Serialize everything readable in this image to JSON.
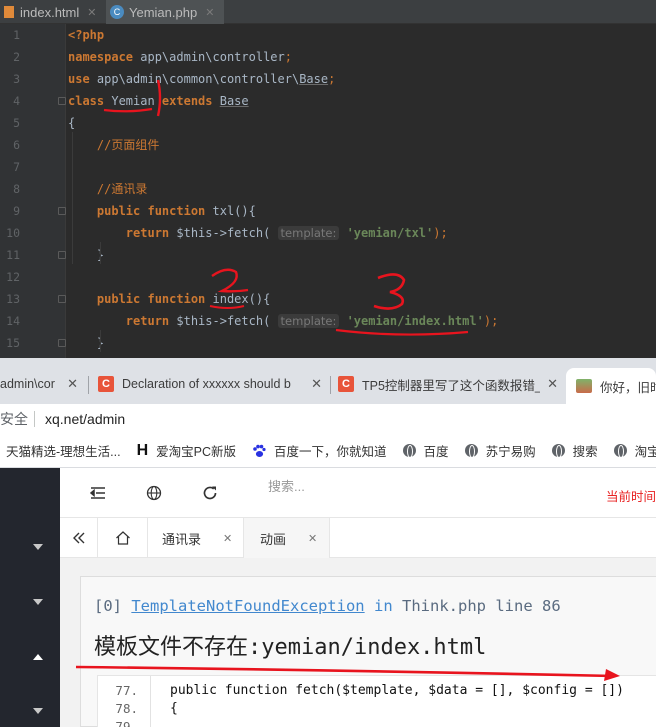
{
  "ide": {
    "tabs": [
      {
        "label": "index.html"
      },
      {
        "label": "Yemian.php"
      }
    ],
    "lines": [
      {
        "n": "1",
        "tokens": [
          {
            "t": "<?php",
            "c": "kw"
          }
        ]
      },
      {
        "n": "2",
        "tokens": [
          {
            "t": "namespace",
            "c": "kw"
          },
          {
            "t": " app\\admin\\controller",
            "c": "ns"
          },
          {
            "t": ";",
            "c": "cmt"
          }
        ]
      },
      {
        "n": "3",
        "tokens": [
          {
            "t": "use",
            "c": "kw"
          },
          {
            "t": " app\\admin\\common\\controller\\",
            "c": "ns"
          },
          {
            "t": "Base",
            "c": "cls"
          },
          {
            "t": ";",
            "c": "cmt"
          }
        ]
      },
      {
        "n": "4",
        "tokens": [
          {
            "t": "class",
            "c": "kw"
          },
          {
            "t": " Yemian ",
            "c": "ns"
          },
          {
            "t": "extends",
            "c": "kw"
          },
          {
            "t": " ",
            "c": "ns"
          },
          {
            "t": "Base",
            "c": "cls"
          }
        ]
      },
      {
        "n": "5",
        "tokens": [
          {
            "t": "{",
            "c": "ns"
          }
        ]
      },
      {
        "n": "6",
        "tokens": [
          {
            "t": "    //页面组件",
            "c": "cmt"
          }
        ]
      },
      {
        "n": "7",
        "tokens": []
      },
      {
        "n": "8",
        "tokens": [
          {
            "t": "    //通讯录",
            "c": "cmt"
          }
        ]
      },
      {
        "n": "9",
        "tokens": [
          {
            "t": "    public function",
            "c": "kw"
          },
          {
            "t": " txl(){",
            "c": "ns"
          }
        ]
      },
      {
        "n": "10",
        "tokens": [
          {
            "t": "        return",
            "c": "kw"
          },
          {
            "t": " $this->fetch( ",
            "c": "var"
          },
          {
            "t": "template:",
            "c": "hint"
          },
          {
            "t": " ",
            "c": "ns"
          },
          {
            "t": "'yemian/txl'",
            "c": "str"
          },
          {
            "t": ");",
            "c": "cmt"
          }
        ]
      },
      {
        "n": "11",
        "tokens": [
          {
            "t": "    }",
            "c": "ns"
          }
        ]
      },
      {
        "n": "12",
        "tokens": []
      },
      {
        "n": "13",
        "tokens": [
          {
            "t": "    public function",
            "c": "kw"
          },
          {
            "t": " index(){",
            "c": "ns"
          }
        ]
      },
      {
        "n": "14",
        "tokens": [
          {
            "t": "        return",
            "c": "kw"
          },
          {
            "t": " $this->fetch( ",
            "c": "var"
          },
          {
            "t": "template:",
            "c": "hint"
          },
          {
            "t": " ",
            "c": "ns"
          },
          {
            "t": "'yemian/index.html'",
            "c": "str"
          },
          {
            "t": ");",
            "c": "cmt"
          }
        ]
      },
      {
        "n": "15",
        "tokens": [
          {
            "t": "    }",
            "c": "ns"
          }
        ]
      }
    ]
  },
  "browser": {
    "tabs": [
      {
        "label": "admin\\cor"
      },
      {
        "label": "Declaration of xxxxxx should b"
      },
      {
        "label": "TP5控制器里写了这个函数报错_"
      },
      {
        "label": "你好，旧时"
      }
    ],
    "address": {
      "security": "安全",
      "url": "xq.net/admin"
    },
    "bookmarks": [
      {
        "label": "天猫精选-理想生活..."
      },
      {
        "label": "爱淘宝PC新版"
      },
      {
        "label": "百度一下，你就知道"
      },
      {
        "label": "百度"
      },
      {
        "label": "苏宁易购"
      },
      {
        "label": "搜索"
      },
      {
        "label": "淘宝"
      }
    ],
    "bookmark_icons": {
      "h": "H"
    },
    "toolbar": {
      "search_placeholder": "搜索...",
      "current_time_label": "当前时间"
    },
    "page_tabs": [
      {
        "label": "通讯录"
      },
      {
        "label": "动画"
      }
    ],
    "error": {
      "index": "[0]",
      "exception": "TemplateNotFoundException",
      "in": "in",
      "file": "Think.php",
      "line_label": "line",
      "line": "86",
      "message": "模板文件不存在:yemian/index.html"
    },
    "source": [
      {
        "n": "77.",
        "code": "public function fetch($template, $data = [], $config = [])"
      },
      {
        "n": "78.",
        "code": "{"
      }
    ]
  },
  "annotations": {
    "one": "1",
    "two": "2",
    "three": "3"
  },
  "colors": {
    "annotation_red": "#e8141e",
    "link_blue": "#4288ce",
    "time_red": "#e82222"
  }
}
